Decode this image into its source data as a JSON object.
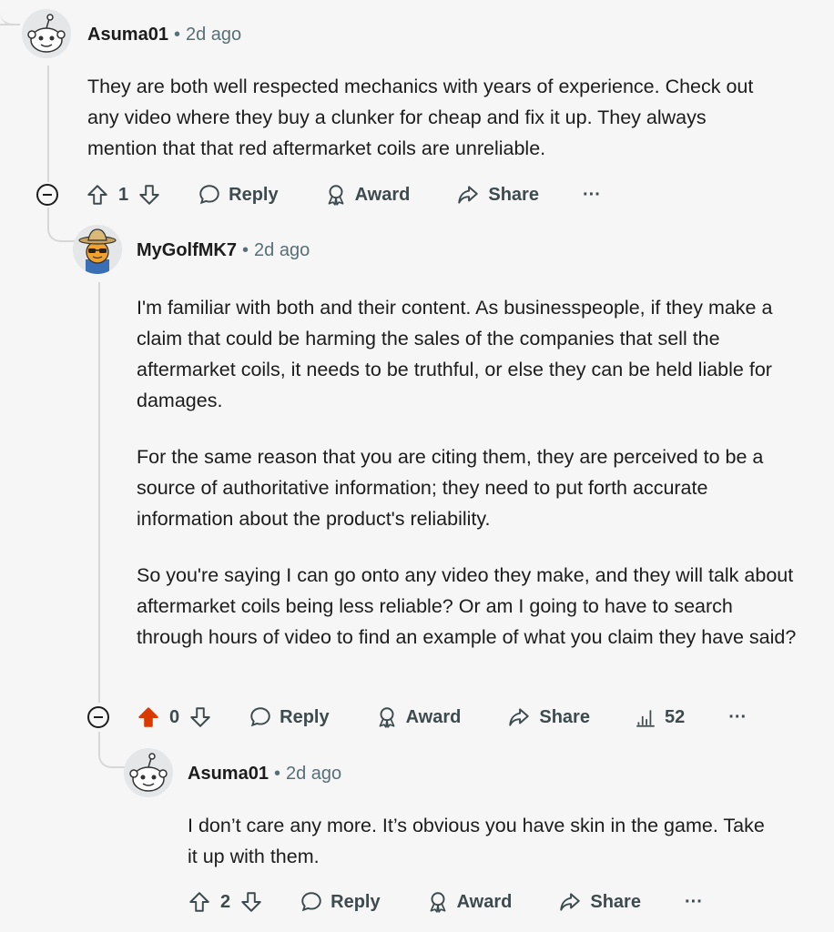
{
  "comments": [
    {
      "user": "Asuma01",
      "time": "2d ago",
      "body": [
        "They are both well respected mechanics with years of experience. Check out any video where they buy a clunker for cheap and fix it up. They always mention that that red aftermarket coils are unreliable."
      ],
      "score": "1",
      "upvoted": false,
      "icon": "snoo-avatar"
    },
    {
      "user": "MyGolfMK7",
      "time": "2d ago",
      "body": [
        "I'm familiar with both and their content. As businesspeople, if they make a claim that could be harming the sales of the companies that sell the aftermarket coils, it needs to be truthful, or else they can be held liable for damages.",
        "For the same reason that you are citing them, they are perceived to be a source of authoritative information; they need to put forth accurate information about the product's reliability.",
        "So you're saying I can go onto any video they make, and they will talk about aftermarket coils being less reliable? Or am I going to have to search through hours of video to find an example of what you claim they have said?"
      ],
      "score": "0",
      "upvoted": true,
      "insights": "52",
      "icon": "cowboy-snoo-avatar"
    },
    {
      "user": "Asuma01",
      "time": "2d ago",
      "body": [
        "I don’t care any more. It’s obvious you have skin in the game. Take it up with them."
      ],
      "score": "2",
      "upvoted": false,
      "icon": "snoo-avatar"
    }
  ],
  "actions": {
    "reply": "Reply",
    "award": "Award",
    "share": "Share",
    "more": "···"
  },
  "colors": {
    "upvote_active": "#d93a00",
    "background": "#f6f6f6",
    "thread_line": "#d7d7d7"
  }
}
